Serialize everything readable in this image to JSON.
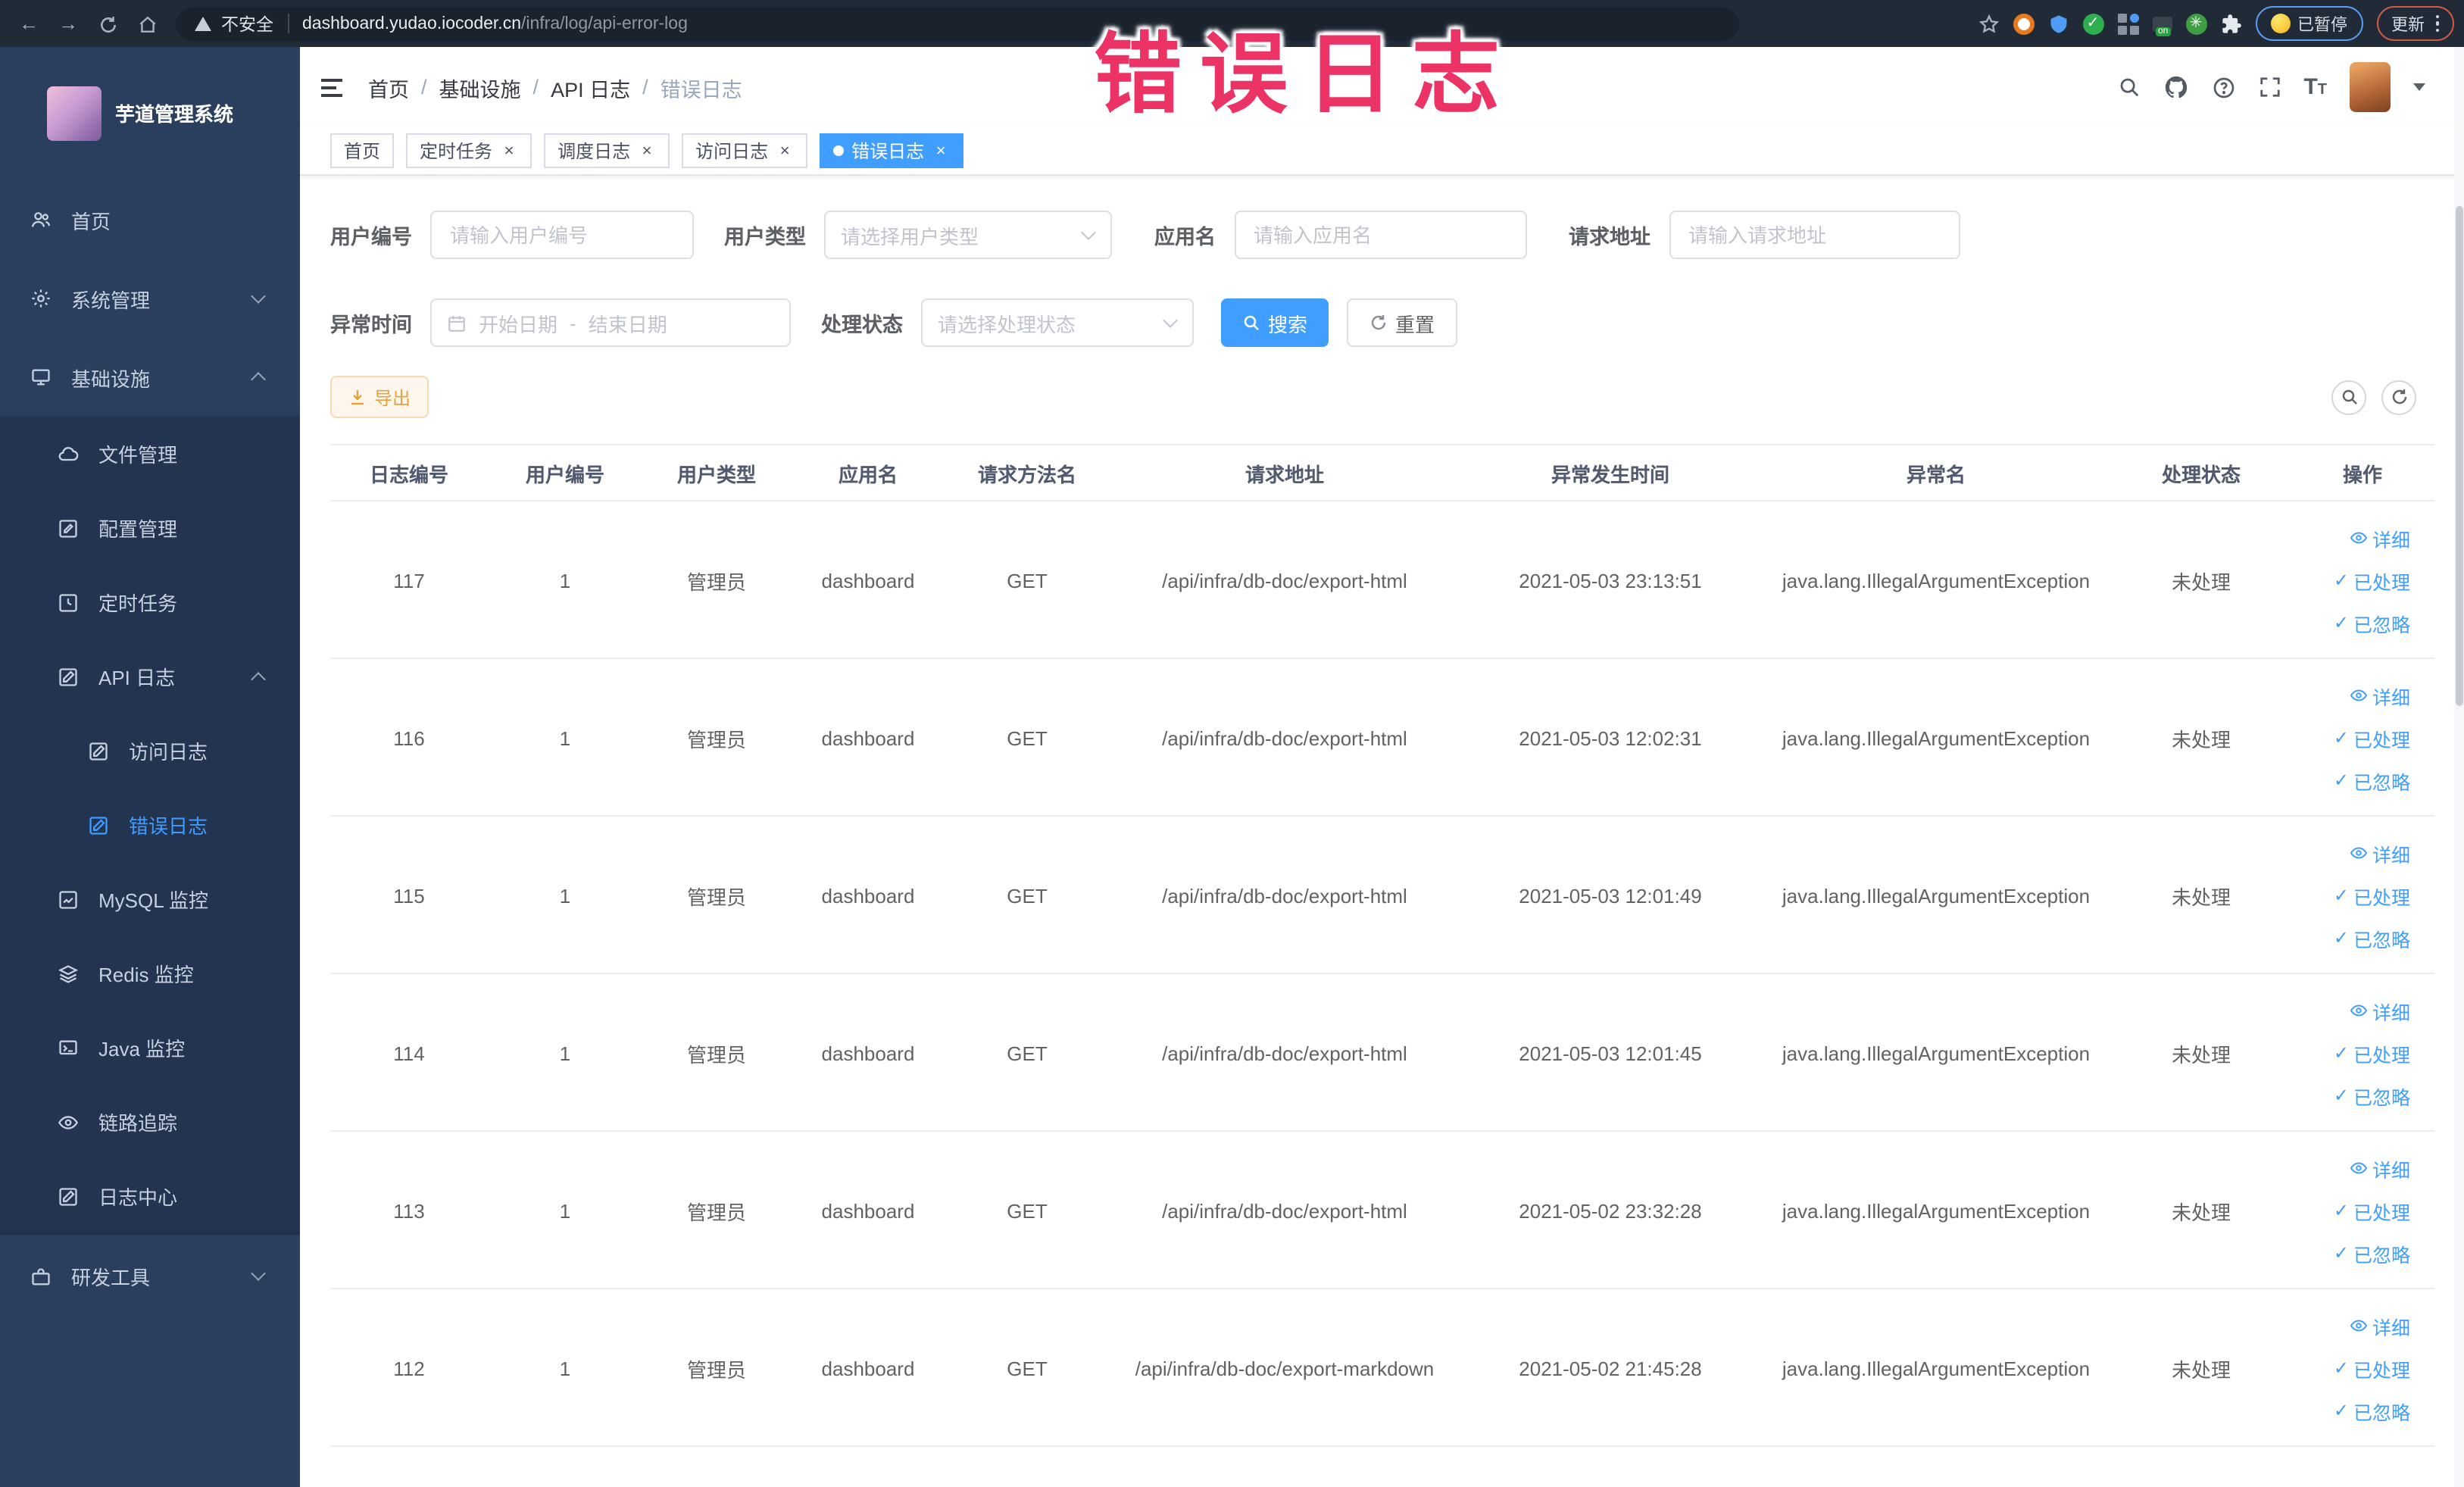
{
  "browser": {
    "security_label": "不安全",
    "url_host": "dashboard.yudao.iocoder.cn",
    "url_path": "/infra/log/api-error-log",
    "paused_button": "已暂停",
    "update_button": "更新"
  },
  "annotation": {
    "text": "错误日志",
    "color": "#ec3365"
  },
  "sidebar": {
    "title": "芋道管理系统",
    "home": "首页",
    "system": "系统管理",
    "infra": "基础设施",
    "file": "文件管理",
    "config": "配置管理",
    "job": "定时任务",
    "apilog": "API 日志",
    "access": "访问日志",
    "error": "错误日志",
    "mysql": "MySQL 监控",
    "redis": "Redis 监控",
    "java": "Java 监控",
    "trace": "链路追踪",
    "logcenter": "日志中心",
    "devtool": "研发工具"
  },
  "breadcrumb": [
    "首页",
    "基础设施",
    "API 日志",
    "错误日志"
  ],
  "tabs": [
    {
      "label": "首页",
      "closable": false,
      "active": false
    },
    {
      "label": "定时任务",
      "closable": true,
      "active": false
    },
    {
      "label": "调度日志",
      "closable": true,
      "active": false
    },
    {
      "label": "访问日志",
      "closable": true,
      "active": false
    },
    {
      "label": "错误日志",
      "closable": true,
      "active": true
    }
  ],
  "filters": {
    "user_id_label": "用户编号",
    "user_id_placeholder": "请输入用户编号",
    "user_type_label": "用户类型",
    "user_type_placeholder": "请选择用户类型",
    "app_label": "应用名",
    "app_placeholder": "请输入应用名",
    "url_label": "请求地址",
    "url_placeholder": "请输入请求地址",
    "time_label": "异常时间",
    "time_start_placeholder": "开始日期",
    "time_separator": "-",
    "time_end_placeholder": "结束日期",
    "status_label": "处理状态",
    "status_placeholder": "请选择处理状态",
    "search_button": "搜索",
    "reset_button": "重置"
  },
  "toolbar": {
    "export_button": "导出"
  },
  "table": {
    "headers": [
      "日志编号",
      "用户编号",
      "用户类型",
      "应用名",
      "请求方法名",
      "请求地址",
      "异常发生时间",
      "异常名",
      "处理状态",
      "操作"
    ],
    "actions": {
      "detail": "详细",
      "process": "已处理",
      "ignore": "已忽略"
    },
    "rows": [
      {
        "id": "117",
        "user_id": "1",
        "user_type": "管理员",
        "app_name": "dashboard",
        "method": "GET",
        "url": "/api/infra/db-doc/export-html",
        "time": "2021-05-03 23:13:51",
        "exception": "java.lang.IllegalArgumentException",
        "status": "未处理"
      },
      {
        "id": "116",
        "user_id": "1",
        "user_type": "管理员",
        "app_name": "dashboard",
        "method": "GET",
        "url": "/api/infra/db-doc/export-html",
        "time": "2021-05-03 12:02:31",
        "exception": "java.lang.IllegalArgumentException",
        "status": "未处理"
      },
      {
        "id": "115",
        "user_id": "1",
        "user_type": "管理员",
        "app_name": "dashboard",
        "method": "GET",
        "url": "/api/infra/db-doc/export-html",
        "time": "2021-05-03 12:01:49",
        "exception": "java.lang.IllegalArgumentException",
        "status": "未处理"
      },
      {
        "id": "114",
        "user_id": "1",
        "user_type": "管理员",
        "app_name": "dashboard",
        "method": "GET",
        "url": "/api/infra/db-doc/export-html",
        "time": "2021-05-03 12:01:45",
        "exception": "java.lang.IllegalArgumentException",
        "status": "未处理"
      },
      {
        "id": "113",
        "user_id": "1",
        "user_type": "管理员",
        "app_name": "dashboard",
        "method": "GET",
        "url": "/api/infra/db-doc/export-html",
        "time": "2021-05-02 23:32:28",
        "exception": "java.lang.IllegalArgumentException",
        "status": "未处理"
      },
      {
        "id": "112",
        "user_id": "1",
        "user_type": "管理员",
        "app_name": "dashboard",
        "method": "GET",
        "url": "/api/infra/db-doc/export-markdown",
        "time": "2021-05-02 21:45:28",
        "exception": "java.lang.IllegalArgumentException",
        "status": "未处理"
      }
    ]
  },
  "colors": {
    "accent": "#409eff",
    "warning": "#e6a23c",
    "sidebar_bg": "#2a3f5e",
    "submenu_bg": "#223450"
  }
}
